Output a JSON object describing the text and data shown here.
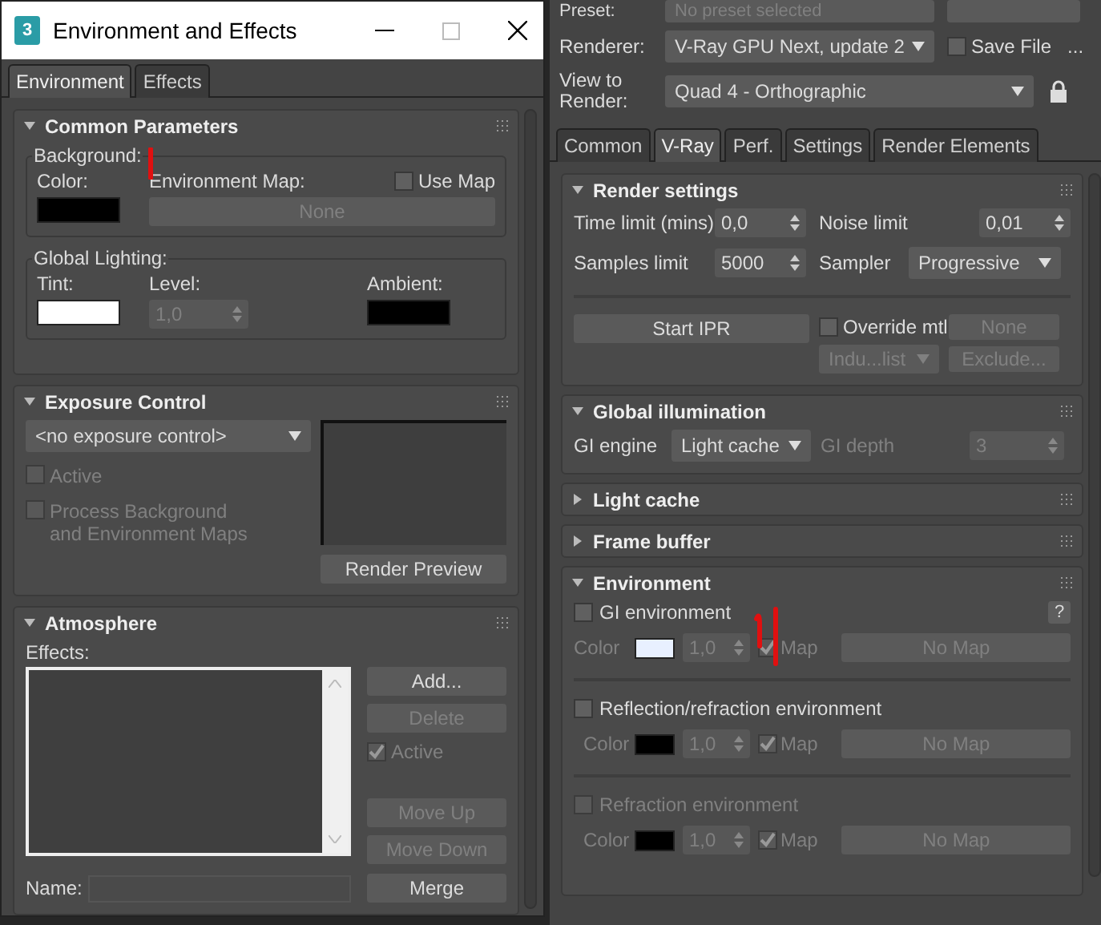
{
  "left_window": {
    "app_icon_label": "3",
    "title": "Environment and Effects",
    "tabs": [
      {
        "label": "Environment",
        "selected": true
      },
      {
        "label": "Effects",
        "selected": false
      }
    ],
    "common_parameters": {
      "title": "Common Parameters",
      "expanded": true,
      "background": {
        "label": "Background:",
        "color_label": "Color:",
        "color": "#000000",
        "map_label": "Environment Map:",
        "use_map": {
          "label": "Use Map",
          "checked": false
        },
        "map_button": "None"
      },
      "global_lighting": {
        "label": "Global Lighting:",
        "tint": {
          "label": "Tint:",
          "color": "#ffffff"
        },
        "level_label": "Level:",
        "level_value": "1,0",
        "ambient": {
          "label": "Ambient:",
          "color": "#000000"
        }
      }
    },
    "exposure_control": {
      "title": "Exposure Control",
      "expanded": true,
      "dropdown": "<no exposure control>",
      "options": [
        {
          "label": "Active",
          "checked": false,
          "disabled": true
        },
        {
          "label": "Process Background\nand Environment Maps",
          "checked": false,
          "disabled": true
        }
      ],
      "preview_button": "Render Preview"
    },
    "atmosphere": {
      "title": "Atmosphere",
      "expanded": true,
      "effects_label": "Effects:",
      "top_buttons": [
        {
          "label": "Add...",
          "disabled": false
        },
        {
          "label": "Delete",
          "disabled": true
        }
      ],
      "active": {
        "label": "Active",
        "checked": true,
        "disabled": true
      },
      "move_buttons": [
        {
          "label": "Move Up",
          "disabled": true
        },
        {
          "label": "Move Down",
          "disabled": true
        }
      ],
      "name_label": "Name:",
      "merge_button": "Merge"
    }
  },
  "right_panel": {
    "preset_label": "Preset:",
    "preset_value": "No preset selected",
    "renderer_label": "Renderer:",
    "renderer": "V-Ray GPU Next, update 2",
    "save_file": {
      "label": "Save File",
      "checked": false
    },
    "more_button": "...",
    "view_label": "View to\nRender:",
    "view": "Quad 4 - Orthographic",
    "tabs": [
      {
        "label": "Common",
        "selected": false
      },
      {
        "label": "V-Ray",
        "selected": true
      },
      {
        "label": "Perf.",
        "selected": false
      },
      {
        "label": "Settings",
        "selected": false
      },
      {
        "label": "Render Elements",
        "selected": false
      }
    ],
    "rollouts": [
      {
        "kind": "render_settings",
        "title": "Render settings",
        "expanded": true,
        "time_limit_label": "Time limit (mins)",
        "time_limit": "0,0",
        "noise_limit_label": "Noise limit",
        "noise_limit": "0,01",
        "samples_limit_label": "Samples limit",
        "samples_limit": "5000",
        "sampler_label": "Sampler",
        "sampler": "Progressive",
        "start_ipr": "Start IPR",
        "override": {
          "label": "Override mtl",
          "checked": false
        },
        "override_material": "None",
        "include_list": "Indu...list",
        "exclude": "Exclude..."
      },
      {
        "kind": "global_illumination",
        "title": "Global illumination",
        "expanded": true,
        "engine_label": "GI engine",
        "engine": "Light cache",
        "depth_label": "GI depth",
        "depth": "3"
      },
      {
        "kind": "light_cache",
        "title": "Light cache",
        "expanded": false
      },
      {
        "kind": "frame_buffer",
        "title": "Frame buffer",
        "expanded": false
      },
      {
        "kind": "environment",
        "title": "Environment",
        "expanded": true,
        "help_button": "?",
        "entries": [
          {
            "label": "GI environment",
            "checked": false,
            "disabled": false,
            "color_label": "Color",
            "color": "#e8f0ff",
            "multiplier": "1,0",
            "map_checked": true,
            "map_label": "Map",
            "map_button": "No Map"
          },
          {
            "label": "Reflection/refraction environment",
            "checked": false,
            "disabled": false,
            "color_label": "Color",
            "color": "#000000",
            "multiplier": "1,0",
            "map_checked": true,
            "map_label": "Map",
            "map_button": "No Map"
          },
          {
            "label": "Refraction environment",
            "checked": false,
            "disabled": true,
            "color_label": "Color",
            "color": "#000000",
            "multiplier": "1,0",
            "map_checked": true,
            "map_label": "Map",
            "map_button": "No Map"
          }
        ]
      }
    ]
  }
}
